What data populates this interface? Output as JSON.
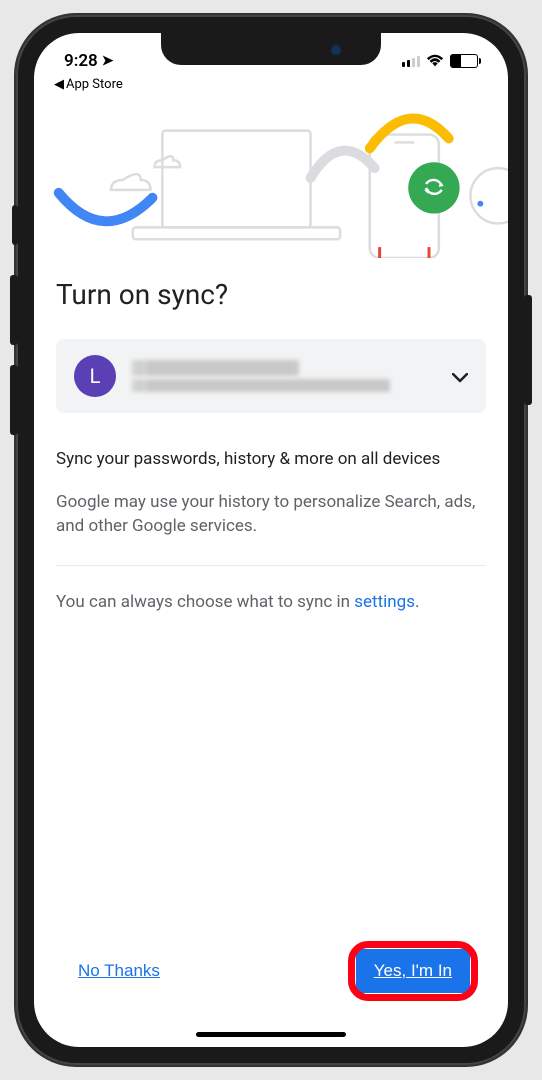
{
  "status": {
    "time": "9:28",
    "breadcrumb_app": "App Store"
  },
  "page": {
    "title": "Turn on sync?"
  },
  "account": {
    "avatar_initial": "L"
  },
  "body": {
    "sync_desc": "Sync your passwords, history & more on all devices",
    "privacy_desc": "Google may use your history to personalize Search, ads, and other Google services.",
    "settings_prefix": "You can always choose what to sync in ",
    "settings_link": "settings",
    "settings_suffix": "."
  },
  "footer": {
    "no_thanks": "No Thanks",
    "yes": "Yes, I'm In"
  }
}
